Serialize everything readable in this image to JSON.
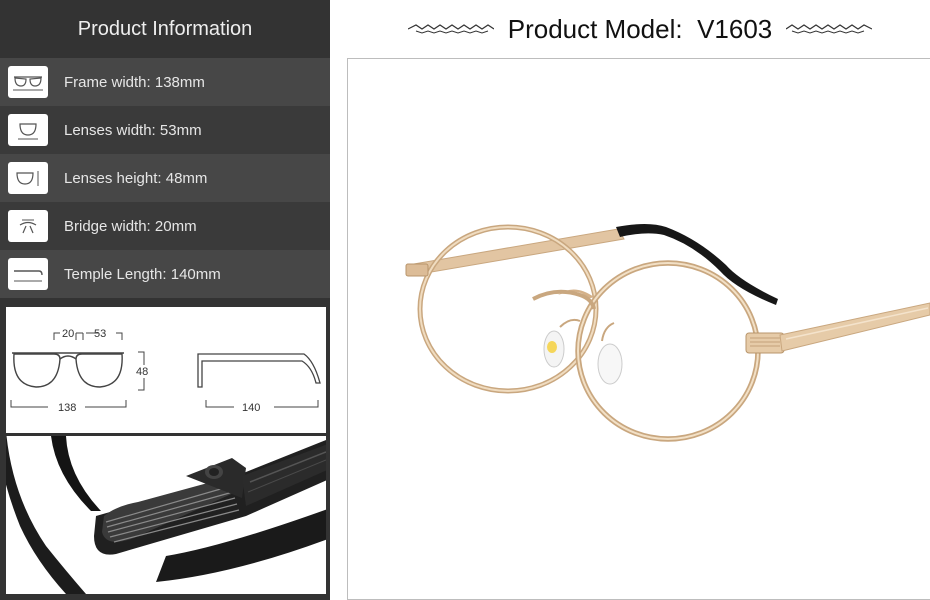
{
  "left_panel": {
    "title": "Product Information",
    "specs": [
      {
        "label": "Frame width:",
        "value": "138mm",
        "icon": "frame-width-icon"
      },
      {
        "label": "Lenses width:",
        "value": "53mm",
        "icon": "lens-width-icon"
      },
      {
        "label": "Lenses height:",
        "value": "48mm",
        "icon": "lens-height-icon"
      },
      {
        "label": "Bridge width:",
        "value": "20mm",
        "icon": "bridge-width-icon"
      },
      {
        "label": "Temple Length:",
        "value": "140mm",
        "icon": "temple-length-icon"
      }
    ],
    "diagram": {
      "bridge": "20",
      "lens_width": "53",
      "lens_height": "48",
      "frame_width": "138",
      "temple_length": "140"
    }
  },
  "header": {
    "label": "Product Model:",
    "model": "V1603"
  },
  "colors": {
    "panel_bg": "#333333",
    "row_light": "#474747",
    "row_dark": "#3a3a3a",
    "frame_gold": "#d9b88f",
    "temple_tip": "#1a1a1a"
  }
}
